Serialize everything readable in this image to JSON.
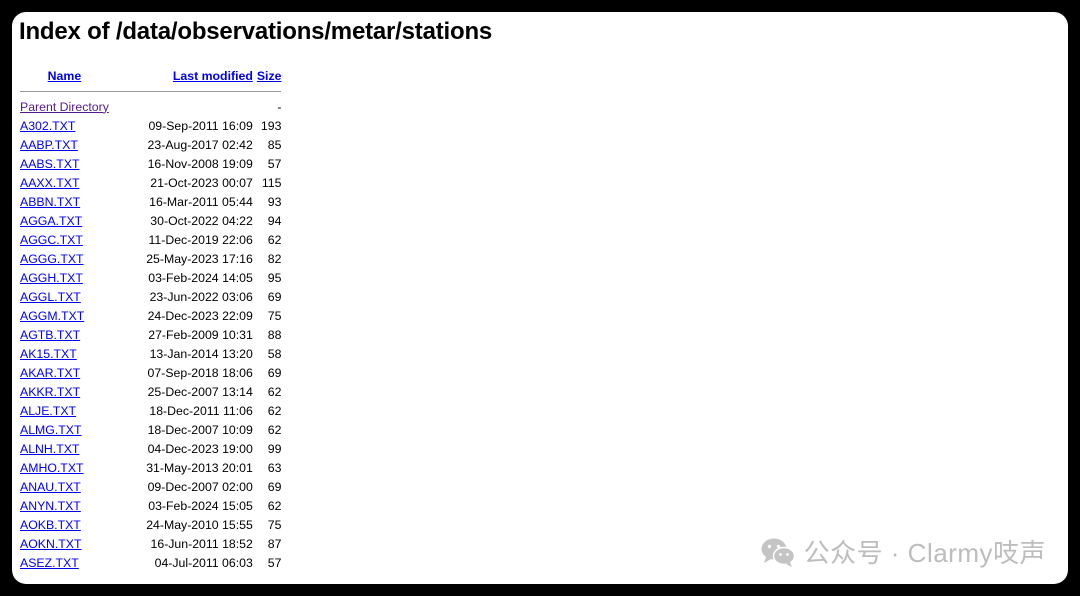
{
  "page": {
    "title": "Index of /data/observations/metar/stations"
  },
  "table": {
    "headers": {
      "name": "Name",
      "last_modified": "Last modified",
      "size": "Size"
    },
    "parent": {
      "label": "Parent Directory",
      "size": "-"
    },
    "rows": [
      {
        "name": "A302.TXT",
        "modified": "09-Sep-2011 16:09",
        "size": "193"
      },
      {
        "name": "AABP.TXT",
        "modified": "23-Aug-2017 02:42",
        "size": "85"
      },
      {
        "name": "AABS.TXT",
        "modified": "16-Nov-2008 19:09",
        "size": "57"
      },
      {
        "name": "AAXX.TXT",
        "modified": "21-Oct-2023 00:07",
        "size": "115"
      },
      {
        "name": "ABBN.TXT",
        "modified": "16-Mar-2011 05:44",
        "size": "93"
      },
      {
        "name": "AGGA.TXT",
        "modified": "30-Oct-2022 04:22",
        "size": "94"
      },
      {
        "name": "AGGC.TXT",
        "modified": "11-Dec-2019 22:06",
        "size": "62"
      },
      {
        "name": "AGGG.TXT",
        "modified": "25-May-2023 17:16",
        "size": "82"
      },
      {
        "name": "AGGH.TXT",
        "modified": "03-Feb-2024 14:05",
        "size": "95"
      },
      {
        "name": "AGGL.TXT",
        "modified": "23-Jun-2022 03:06",
        "size": "69"
      },
      {
        "name": "AGGM.TXT",
        "modified": "24-Dec-2023 22:09",
        "size": "75"
      },
      {
        "name": "AGTB.TXT",
        "modified": "27-Feb-2009 10:31",
        "size": "88"
      },
      {
        "name": "AK15.TXT",
        "modified": "13-Jan-2014 13:20",
        "size": "58"
      },
      {
        "name": "AKAR.TXT",
        "modified": "07-Sep-2018 18:06",
        "size": "69"
      },
      {
        "name": "AKKR.TXT",
        "modified": "25-Dec-2007 13:14",
        "size": "62"
      },
      {
        "name": "ALJE.TXT",
        "modified": "18-Dec-2011 11:06",
        "size": "62"
      },
      {
        "name": "ALMG.TXT",
        "modified": "18-Dec-2007 10:09",
        "size": "62"
      },
      {
        "name": "ALNH.TXT",
        "modified": "04-Dec-2023 19:00",
        "size": "99"
      },
      {
        "name": "AMHO.TXT",
        "modified": "31-May-2013 20:01",
        "size": "63"
      },
      {
        "name": "ANAU.TXT",
        "modified": "09-Dec-2007 02:00",
        "size": "69"
      },
      {
        "name": "ANYN.TXT",
        "modified": "03-Feb-2024 15:05",
        "size": "62"
      },
      {
        "name": "AOKB.TXT",
        "modified": "24-May-2010 15:55",
        "size": "75"
      },
      {
        "name": "AOKN.TXT",
        "modified": "16-Jun-2011 18:52",
        "size": "87"
      },
      {
        "name": "ASEZ.TXT",
        "modified": "04-Jul-2011 06:03",
        "size": "57"
      }
    ]
  },
  "watermark": {
    "icon": "wechat-icon",
    "text": "公众号 · Clarmy吱声"
  }
}
